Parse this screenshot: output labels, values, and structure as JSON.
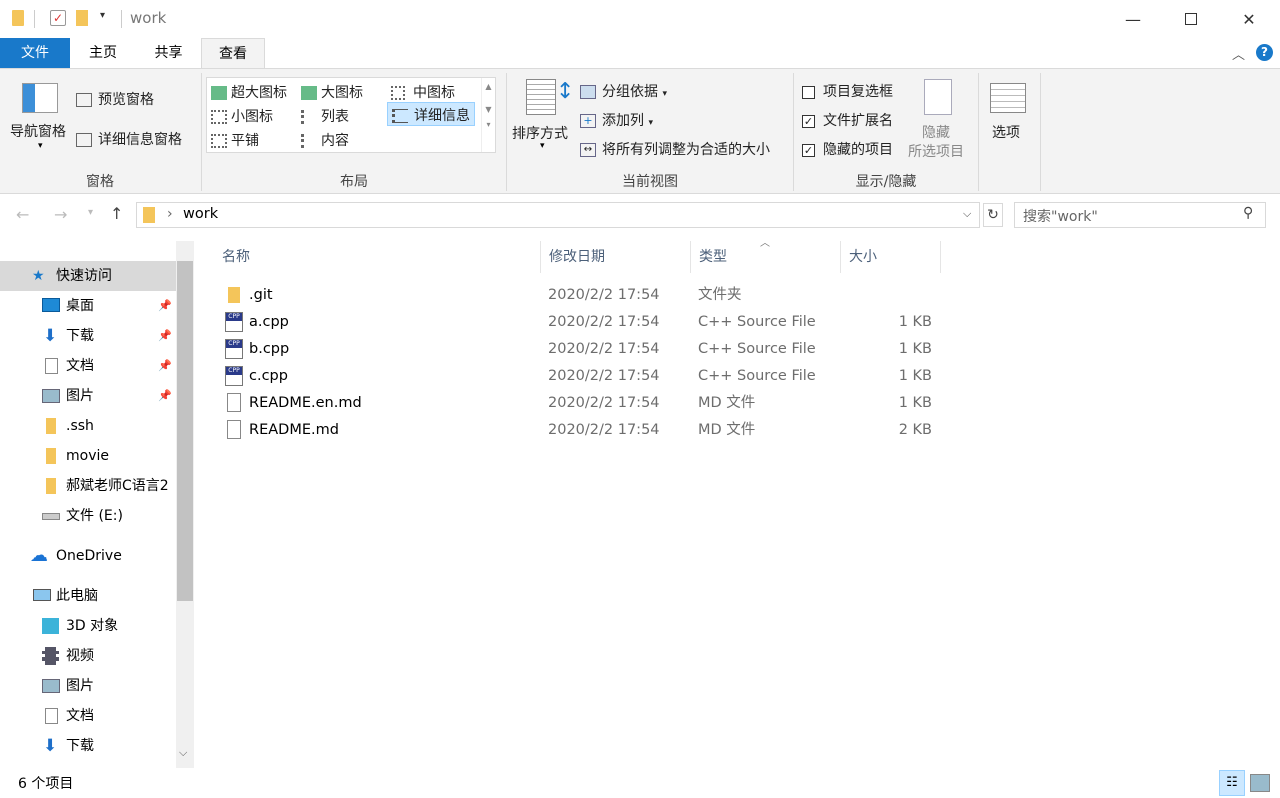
{
  "window": {
    "title": "work"
  },
  "tabs": [
    "文件",
    "主页",
    "共享",
    "查看"
  ],
  "ribbon": {
    "pane_group": {
      "nav_pane": "导航窗格",
      "preview_pane": "预览窗格",
      "details_pane": "详细信息窗格",
      "label": "窗格"
    },
    "layout_group": {
      "items": [
        "超大图标",
        "大图标",
        "中图标",
        "小图标",
        "列表",
        "详细信息",
        "平铺",
        "内容"
      ],
      "label": "布局"
    },
    "current_view_group": {
      "sort_by": "排序方式",
      "group_by": "分组依据",
      "add_column": "添加列",
      "fit_columns": "将所有列调整为合适的大小",
      "label": "当前视图"
    },
    "show_hide_group": {
      "item_checkboxes": "项目复选框",
      "file_extensions": "文件扩展名",
      "hidden_items": "隐藏的项目",
      "hide_selected_line1": "隐藏",
      "hide_selected_line2": "所选项目",
      "label": "显示/隐藏",
      "checked": [
        false,
        true,
        true
      ]
    },
    "options": "选项"
  },
  "address": {
    "path": "work",
    "search_placeholder": "搜索\"work\""
  },
  "nav": {
    "quick_access": "快速访问",
    "pinned": [
      "桌面",
      "下载",
      "文档",
      "图片"
    ],
    "folders": [
      ".ssh",
      "movie",
      "郝斌老师C语言2"
    ],
    "drive": "文件 (E:)",
    "onedrive": "OneDrive",
    "this_pc": "此电脑",
    "pc_items": [
      "3D 对象",
      "视频",
      "图片",
      "文档",
      "下载"
    ]
  },
  "columns": {
    "name": "名称",
    "date": "修改日期",
    "type": "类型",
    "size": "大小"
  },
  "files": [
    {
      "name": ".git",
      "date": "2020/2/2 17:54",
      "type": "文件夹",
      "size": "",
      "icon": "folder-icon"
    },
    {
      "name": "a.cpp",
      "date": "2020/2/2 17:54",
      "type": "C++ Source File",
      "size": "1 KB",
      "icon": "cpp-file-icon"
    },
    {
      "name": "b.cpp",
      "date": "2020/2/2 17:54",
      "type": "C++ Source File",
      "size": "1 KB",
      "icon": "cpp-file-icon"
    },
    {
      "name": "c.cpp",
      "date": "2020/2/2 17:54",
      "type": "C++ Source File",
      "size": "1 KB",
      "icon": "cpp-file-icon"
    },
    {
      "name": "README.en.md",
      "date": "2020/2/2 17:54",
      "type": "MD 文件",
      "size": "1 KB",
      "icon": "text-file-icon"
    },
    {
      "name": "README.md",
      "date": "2020/2/2 17:54",
      "type": "MD 文件",
      "size": "2 KB",
      "icon": "text-file-icon"
    }
  ],
  "status": {
    "count": "6 个项目"
  },
  "colors": {
    "accent": "#1979ca",
    "folder": "#f4c55a",
    "selected": "#cce8ff"
  }
}
